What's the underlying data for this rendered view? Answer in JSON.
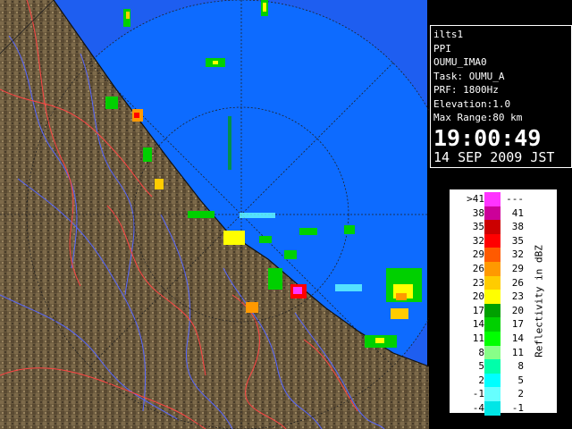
{
  "info": {
    "site": "ilts1",
    "scan_type": "PPI",
    "product": "OUMU_IMA0",
    "task": "Task: OUMU_A",
    "prf": "PRF: 1800Hz",
    "elevation": "Elevation:1.0",
    "max_range": "Max Range:80 km",
    "time": "19:00:49",
    "date": "14 SEP 2009 JST"
  },
  "legend": {
    "unit": "Reflectivity in dBZ",
    "rows": [
      {
        "lo": ">41",
        "hi": "---",
        "color": "#ff33ff"
      },
      {
        "lo": "38",
        "hi": "41",
        "color": "#cc0099"
      },
      {
        "lo": "35",
        "hi": "38",
        "color": "#cc0000"
      },
      {
        "lo": "32",
        "hi": "35",
        "color": "#ff0000"
      },
      {
        "lo": "29",
        "hi": "32",
        "color": "#ff5a00"
      },
      {
        "lo": "26",
        "hi": "29",
        "color": "#ff9900"
      },
      {
        "lo": "23",
        "hi": "26",
        "color": "#ffcc00"
      },
      {
        "lo": "20",
        "hi": "23",
        "color": "#ffff00"
      },
      {
        "lo": "17",
        "hi": "20",
        "color": "#00a000"
      },
      {
        "lo": "14",
        "hi": "17",
        "color": "#00d000"
      },
      {
        "lo": "11",
        "hi": "14",
        "color": "#00ff00"
      },
      {
        "lo": "8",
        "hi": "11",
        "color": "#88ff88"
      },
      {
        "lo": "5",
        "hi": "8",
        "color": "#00ffaa"
      },
      {
        "lo": "2",
        "hi": "5",
        "color": "#00ffff"
      },
      {
        "lo": "-1",
        "hi": "2",
        "color": "#66ffff"
      },
      {
        "lo": "-4",
        "hi": "-1",
        "color": "#00e6e6"
      }
    ]
  },
  "map_colors": {
    "sea_outer": "#1e5ef0",
    "sea_inner": "#0d6bff",
    "land": "#6b5a3e",
    "rivers": "#5566ff",
    "borders": "#ff4444"
  }
}
